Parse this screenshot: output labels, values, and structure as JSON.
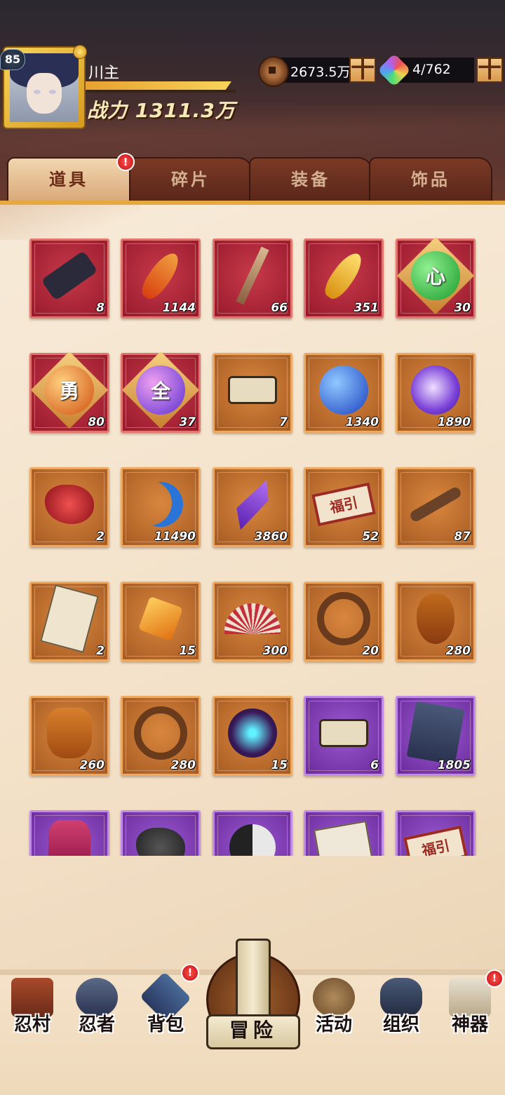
{
  "player": {
    "level": "85",
    "name": "川主",
    "power": "战力 1311.3万"
  },
  "resources": {
    "coins": "2673.5万",
    "gems": "4/762",
    "plus_label": "十"
  },
  "tabs": [
    {
      "label": "道具",
      "active": true,
      "badge": "!"
    },
    {
      "label": "碎片",
      "active": false
    },
    {
      "label": "装备",
      "active": false
    },
    {
      "label": "饰品",
      "active": false
    }
  ],
  "items": [
    {
      "icon": "scroll-bundle-icon",
      "frame": "red",
      "count": "8"
    },
    {
      "icon": "flame-feather-icon",
      "frame": "red",
      "count": "1144"
    },
    {
      "icon": "wooden-stick-icon",
      "frame": "red",
      "count": "66"
    },
    {
      "icon": "golden-feather-icon",
      "frame": "red",
      "count": "351"
    },
    {
      "icon": "heart-orb-icon",
      "frame": "red",
      "count": "30",
      "glyph": "心"
    },
    {
      "icon": "courage-orb-icon",
      "frame": "red",
      "count": "80",
      "glyph": "勇"
    },
    {
      "icon": "all-orb-icon",
      "frame": "red",
      "count": "37",
      "glyph": "全"
    },
    {
      "icon": "scroll-icon",
      "frame": "orange",
      "count": "7"
    },
    {
      "icon": "blue-orb-icon",
      "frame": "orange",
      "count": "1340"
    },
    {
      "icon": "purple-orb-icon",
      "frame": "orange",
      "count": "1890"
    },
    {
      "icon": "red-crystal-icon",
      "frame": "orange",
      "count": "2"
    },
    {
      "icon": "crescent-moon-icon",
      "frame": "orange",
      "count": "11490"
    },
    {
      "icon": "purple-crystal-icon",
      "frame": "orange",
      "count": "3860"
    },
    {
      "icon": "lucky-ticket-icon",
      "frame": "orange",
      "count": "52",
      "glyph": "福引"
    },
    {
      "icon": "key-icon",
      "frame": "orange",
      "count": "87"
    },
    {
      "icon": "paper-charm-icon",
      "frame": "orange",
      "count": "2"
    },
    {
      "icon": "amber-gem-icon",
      "frame": "orange",
      "count": "15"
    },
    {
      "icon": "fan-icon",
      "frame": "orange",
      "count": "300"
    },
    {
      "icon": "rope-icon",
      "frame": "orange",
      "count": "20"
    },
    {
      "icon": "gourd-icon",
      "frame": "orange",
      "count": "280"
    },
    {
      "icon": "jar-icon",
      "frame": "orange",
      "count": "260"
    },
    {
      "icon": "needles-icon",
      "frame": "orange",
      "count": "280"
    },
    {
      "icon": "blue-flame-orb-icon",
      "frame": "orange",
      "count": "15"
    },
    {
      "icon": "purple-scroll-icon",
      "frame": "purple",
      "count": "6"
    },
    {
      "icon": "skill-book-icon",
      "frame": "purple",
      "count": "1805"
    },
    {
      "icon": "potion-bottle-icon",
      "frame": "purple",
      "count": ""
    },
    {
      "icon": "black-stone-icon",
      "frame": "purple",
      "count": ""
    },
    {
      "icon": "yin-yang-icon",
      "frame": "purple",
      "count": ""
    },
    {
      "icon": "paper-cards-icon",
      "frame": "purple",
      "count": ""
    },
    {
      "icon": "lucky-ticket-icon",
      "frame": "purple",
      "count": "",
      "glyph": "福引"
    }
  ],
  "nav": [
    {
      "id": "village",
      "label": "忍村",
      "icon": "village-gate-icon"
    },
    {
      "id": "ninja",
      "label": "忍者",
      "icon": "ninja-head-icon"
    },
    {
      "id": "bag",
      "label": "背包",
      "icon": "backpack-icon",
      "badge": "!"
    },
    {
      "id": "adventure",
      "label": "冒险",
      "icon": "adventure-scroll-icon"
    },
    {
      "id": "activity",
      "label": "活动",
      "icon": "kunai-icon"
    },
    {
      "id": "organization",
      "label": "组织",
      "icon": "ninja-group-icon"
    },
    {
      "id": "artifact",
      "label": "神器",
      "icon": "artifact-scroll-icon",
      "badge": "!"
    }
  ]
}
